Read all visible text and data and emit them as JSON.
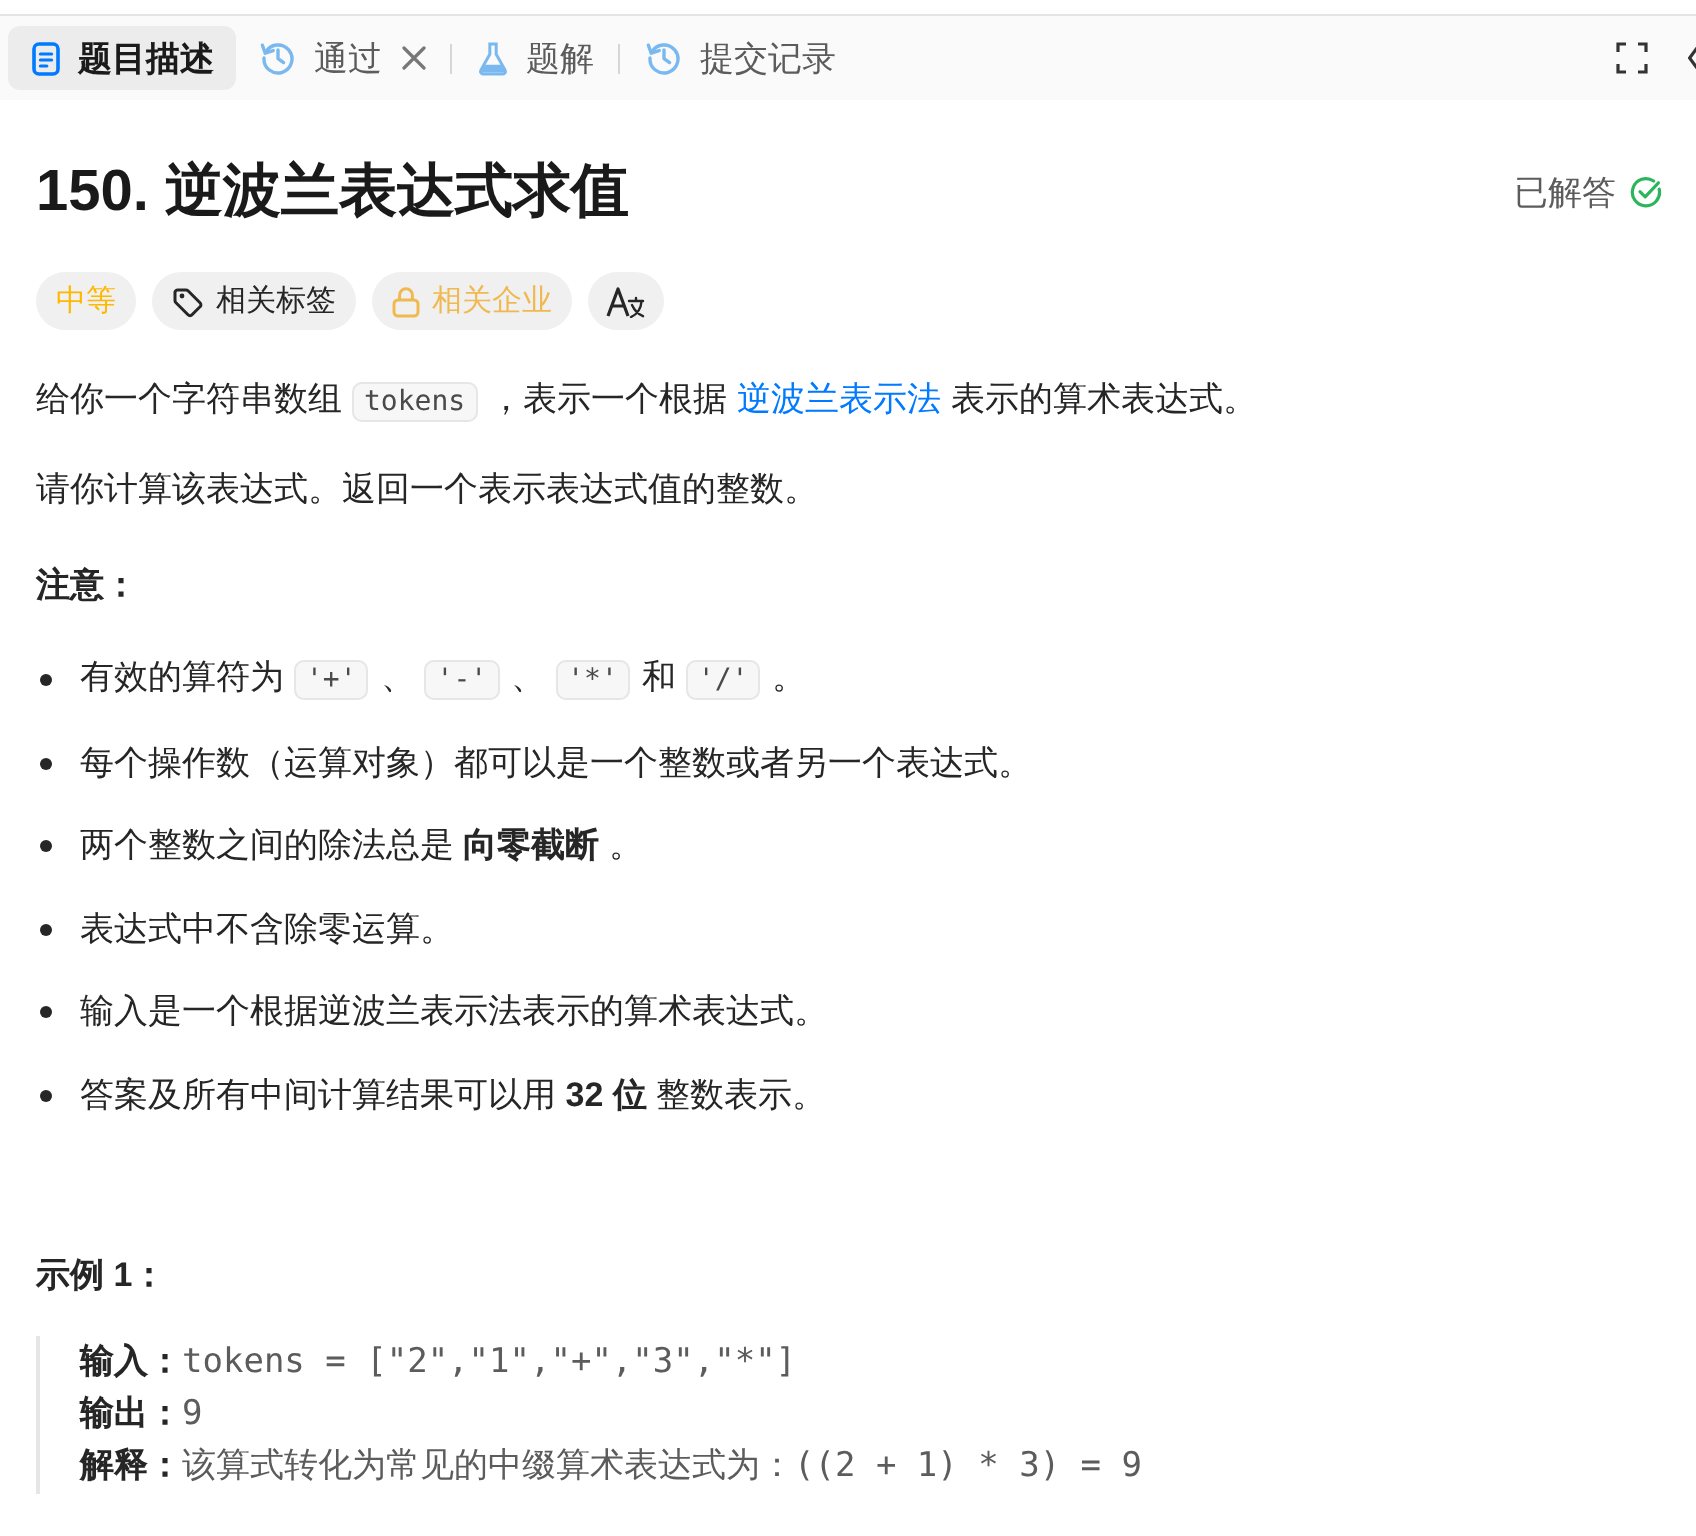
{
  "tabs": [
    {
      "label": "题目描述",
      "selected": true,
      "closable": false
    },
    {
      "label": "通过",
      "selected": false,
      "closable": true
    },
    {
      "label": "题解",
      "selected": false,
      "closable": false
    },
    {
      "label": "提交记录",
      "selected": false,
      "closable": false
    }
  ],
  "problem": {
    "title": "150. 逆波兰表达式求值",
    "status": {
      "label": "已解答",
      "solved": true
    },
    "tags": [
      {
        "kind": "difficulty",
        "label": "中等"
      },
      {
        "kind": "topics",
        "label": "相关标签"
      },
      {
        "kind": "companies",
        "label": "相关企业",
        "locked": true
      },
      {
        "kind": "translate"
      }
    ],
    "description": [
      [
        {
          "kind": "text",
          "text": "给你一个字符串数组"
        },
        {
          "kind": "code",
          "text": "tokens"
        },
        {
          "kind": "text",
          "text": "，表示一个根据"
        },
        {
          "kind": "link",
          "text": "逆波兰表示法"
        },
        {
          "kind": "text",
          "text": "表示的算术表达式。"
        }
      ],
      [
        {
          "kind": "text",
          "text": "请你计算该表达式。返回一个表示表达式值的整数。"
        }
      ]
    ],
    "notes_heading": "注意：",
    "notes": [
      [
        {
          "kind": "text",
          "text": "有效的算符为"
        },
        {
          "kind": "code",
          "text": "'+'"
        },
        {
          "kind": "text",
          "text": "、"
        },
        {
          "kind": "code",
          "text": "'-'"
        },
        {
          "kind": "text",
          "text": "、"
        },
        {
          "kind": "code",
          "text": "'*'"
        },
        {
          "kind": "text",
          "text": "和"
        },
        {
          "kind": "code",
          "text": "'/'"
        },
        {
          "kind": "text",
          "text": "。"
        }
      ],
      [
        {
          "kind": "text",
          "text": "每个操作数（运算对象）都可以是一个整数或者另一个表达式。"
        }
      ],
      [
        {
          "kind": "text",
          "text": "两个整数之间的除法总是 **向零截断** 。"
        }
      ],
      [
        {
          "kind": "text",
          "text": "表达式中不含除零运算。"
        }
      ],
      [
        {
          "kind": "text",
          "text": "输入是一个根据逆波兰表示法表示的算术表达式。"
        }
      ],
      [
        {
          "kind": "text",
          "text": "答案及所有中间计算结果可以用 **32 位** 整数表示。"
        }
      ]
    ],
    "examples": [
      {
        "heading": "示例 1：",
        "lines": [
          {
            "label": "输入：",
            "value": "tokens = [\"2\",\"1\",\"+\",\"3\",\"*\"]"
          },
          {
            "label": "输出：",
            "value": "9"
          },
          {
            "label": "解释：",
            "value": "该算式转化为常见的中缀算术表达式为：((2 + 1) * 3) = 9"
          }
        ]
      }
    ]
  }
}
